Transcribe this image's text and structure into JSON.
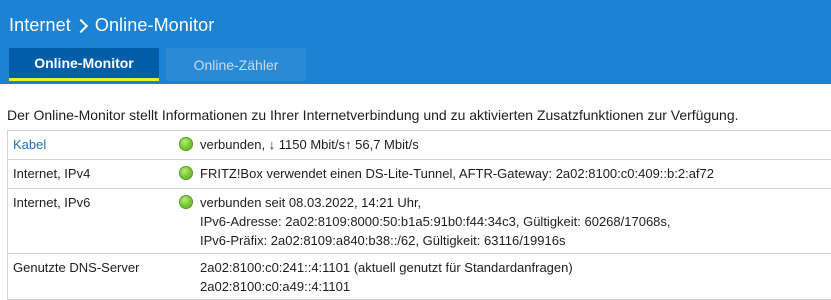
{
  "header": {
    "breadcrumb": [
      "Internet",
      "Online-Monitor"
    ],
    "tabs": [
      {
        "label": "Online-Monitor",
        "active": true
      },
      {
        "label": "Online-Zähler",
        "active": false
      }
    ],
    "colors": {
      "bar": "#1c82d3",
      "active_tab": "#005ea8",
      "active_underline": "#e8ef2f"
    }
  },
  "intro": "Der Online-Monitor stellt Informationen zu Ihrer Internetverbindung und zu aktivierten Zusatzfunktionen zur Verfügung.",
  "rows": [
    {
      "label": "Kabel",
      "status": "green-led",
      "lines": [
        "verbunden, ↓ 1150 Mbit/s↑ 56,7 Mbit/s"
      ]
    },
    {
      "label": "Internet, IPv4",
      "status": "green-led",
      "lines": [
        "FRITZ!Box verwendet einen DS-Lite-Tunnel, AFTR-Gateway: 2a02:8100:c0:409::b:2:af72"
      ]
    },
    {
      "label": "Internet, IPv6",
      "status": "green-led",
      "lines": [
        "verbunden seit 08.03.2022, 14:21 Uhr,",
        "IPv6-Adresse: 2a02:8109:8000:50:b1a5:91b0:f44:34c3, Gültigkeit: 60268/17068s,",
        "IPv6-Präfix: 2a02:8109:a840:b38::/62, Gültigkeit: 63116/19916s"
      ]
    },
    {
      "label": "Genutzte DNS-Server",
      "status": "",
      "lines": [
        "2a02:8100:c0:241::4:1101 (aktuell genutzt für Standardanfragen)",
        "2a02:8100:c0:a49::4:1101"
      ]
    }
  ]
}
